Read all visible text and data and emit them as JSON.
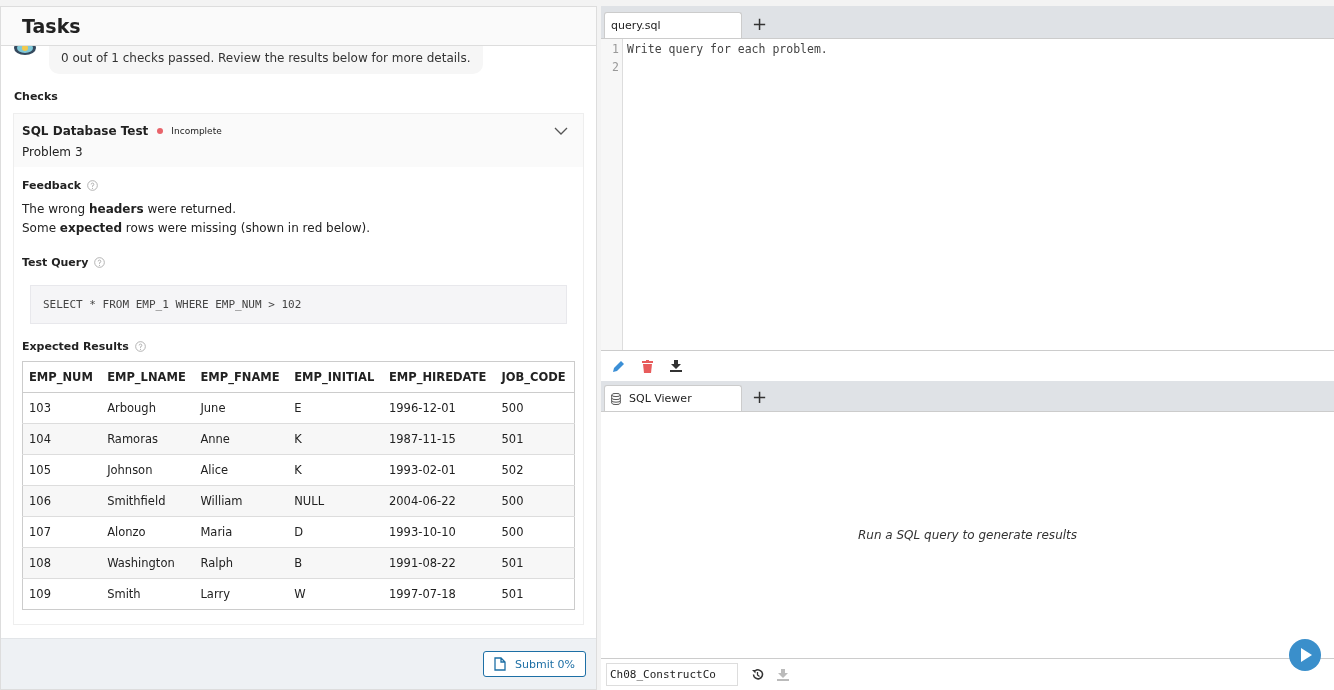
{
  "tasks_panel": {
    "title": "Tasks",
    "message": "0 out of 1 checks passed. Review the results below for more details.",
    "checks_heading": "Checks",
    "check": {
      "name": "SQL Database Test",
      "status": "Incomplete",
      "color": "#e8636a",
      "expanded": true,
      "problem": "Problem 3",
      "feedback_label": "Feedback",
      "feedback": [
        "The wrong **headers** were returned.",
        "Some **expected** rows were missing (shown in red below)."
      ],
      "test_query_label": "Test Query",
      "test_query": "SELECT * FROM EMP_1 WHERE EMP_NUM > 102",
      "expected_label": "Expected Results",
      "table": {
        "columns": [
          "EMP_NUM",
          "EMP_LNAME",
          "EMP_FNAME",
          "EMP_INITIAL",
          "EMP_HIREDATE",
          "JOB_CODE"
        ],
        "rows": [
          [
            "103",
            "Arbough",
            "June",
            "E",
            "1996-12-01",
            "500"
          ],
          [
            "104",
            "Ramoras",
            "Anne",
            "K",
            "1987-11-15",
            "501"
          ],
          [
            "105",
            "Johnson",
            "Alice",
            "K",
            "1993-02-01",
            "502"
          ],
          [
            "106",
            "Smithfield",
            "William",
            "NULL",
            "2004-06-22",
            "500"
          ],
          [
            "107",
            "Alonzo",
            "Maria",
            "D",
            "1993-10-10",
            "500"
          ],
          [
            "108",
            "Washington",
            "Ralph",
            "B",
            "1991-08-22",
            "501"
          ],
          [
            "109",
            "Smith",
            "Larry",
            "W",
            "1997-07-18",
            "501"
          ]
        ]
      }
    },
    "submit_button": "Submit 0%"
  },
  "editor": {
    "tabs": [
      {
        "label": "query.sql",
        "selected": true
      }
    ],
    "add_tab": "+",
    "lines": [
      {
        "number": "1",
        "text": "Write query for each problem."
      },
      {
        "number": "2"
      }
    ]
  },
  "viewer": {
    "tabs": [
      {
        "label": "SQL Viewer",
        "selected": true
      }
    ],
    "add_tab": "+",
    "empty_message": "Run a SQL query to generate results"
  },
  "footer": {
    "file_name": "Ch08_ConstructCo",
    "download_disabled": true
  }
}
